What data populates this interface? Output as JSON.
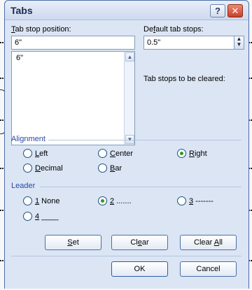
{
  "dialog": {
    "title": "Tabs",
    "help_label": "?",
    "close_label": "✕"
  },
  "tab_stop": {
    "label_prefix": "T",
    "label_rest": "ab stop position:",
    "value": "6\"",
    "list_items": [
      "6\""
    ]
  },
  "default_tabs": {
    "label_prefix": "De",
    "label_u": "f",
    "label_rest": "ault tab stops:",
    "value": "0.5\""
  },
  "clear_text": "Tab stops to be cleared:",
  "alignment": {
    "title": "Alignment",
    "options": [
      {
        "u": "L",
        "rest": "eft",
        "selected": false
      },
      {
        "u": "C",
        "rest": "enter",
        "selected": false
      },
      {
        "u": "R",
        "rest": "ight",
        "selected": true
      },
      {
        "u": "D",
        "rest": "ecimal",
        "selected": false
      },
      {
        "u": "B",
        "rest": "ar",
        "selected": false
      }
    ]
  },
  "leader": {
    "title": "Leader",
    "options": [
      {
        "u": "1",
        "rest": " None",
        "selected": false
      },
      {
        "u": "2",
        "rest": " .......",
        "selected": true
      },
      {
        "u": "3",
        "rest": " -------",
        "selected": false
      },
      {
        "u": "4",
        "rest": " ____",
        "selected": false
      }
    ]
  },
  "buttons": {
    "set_u": "S",
    "set_rest": "et",
    "clear_pre": "Cl",
    "clear_u": "e",
    "clear_rest": "ar",
    "clear_all_pre": "Clear ",
    "clear_all_u": "A",
    "clear_all_rest": "ll",
    "ok": "OK",
    "cancel": "Cancel"
  },
  "colors": {
    "group_title": "#2749a6",
    "radio_selected": "#2a9b2a",
    "close_red": "#c8402a"
  }
}
